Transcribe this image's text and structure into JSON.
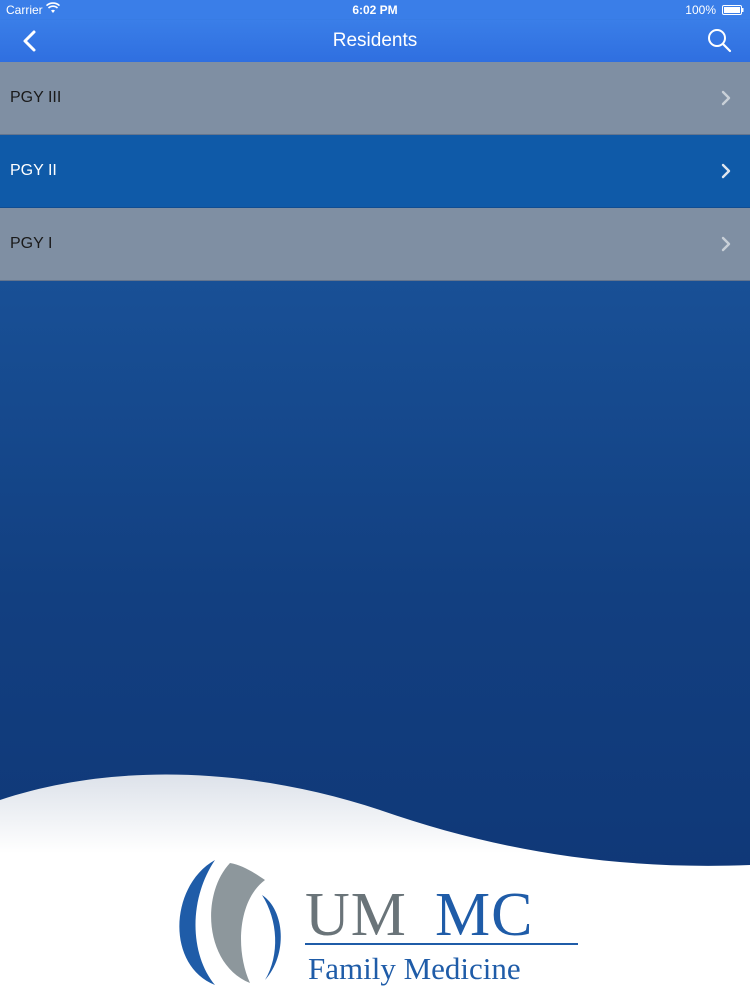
{
  "status": {
    "carrier": "Carrier",
    "time": "6:02 PM",
    "battery": "100%"
  },
  "nav": {
    "title": "Residents",
    "back_icon": "chevron-left-icon",
    "search_icon": "search-icon"
  },
  "rows": [
    {
      "label": "PGY III",
      "style": "grey"
    },
    {
      "label": "PGY II",
      "style": "blue"
    },
    {
      "label": "PGY I",
      "style": "grey"
    }
  ],
  "logo": {
    "name": "UMMC",
    "subtitle": "Family Medicine"
  },
  "colors": {
    "nav": "#3a7ee8",
    "row_grey": "#7f8fa3",
    "row_blue": "#0f5aa8",
    "logo_blue": "#1f5ca8",
    "logo_grey": "#6a7479"
  }
}
